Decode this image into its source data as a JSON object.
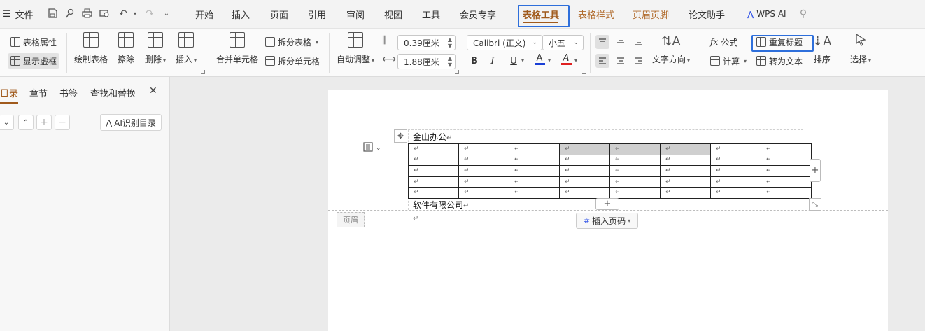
{
  "menubar": {
    "menu_icon": "☰",
    "file_label": "文件",
    "icons": [
      "save-icon",
      "brush-icon",
      "print-icon",
      "print-preview-icon",
      "undo-icon",
      "redo-icon"
    ],
    "tabs": [
      {
        "label": "开始",
        "name": "tab-home"
      },
      {
        "label": "插入",
        "name": "tab-insert"
      },
      {
        "label": "页面",
        "name": "tab-page"
      },
      {
        "label": "引用",
        "name": "tab-reference"
      },
      {
        "label": "审阅",
        "name": "tab-review"
      },
      {
        "label": "视图",
        "name": "tab-view"
      },
      {
        "label": "工具",
        "name": "tab-tools"
      },
      {
        "label": "会员专享",
        "name": "tab-member"
      },
      {
        "label": "表格工具",
        "name": "tab-table-tools"
      },
      {
        "label": "表格样式",
        "name": "tab-table-style"
      },
      {
        "label": "页眉页脚",
        "name": "tab-header-footer"
      },
      {
        "label": "论文助手",
        "name": "tab-paper-assistant"
      }
    ],
    "active_tab": "表格工具",
    "wps_ai_label": "WPS AI"
  },
  "ribbon": {
    "table_props": "表格属性",
    "show_gridlines": "显示虚框",
    "draw_table": "绘制表格",
    "erase": "擦除",
    "delete": "删除",
    "insert": "插入",
    "merge_cells": "合并单元格",
    "split_table": "拆分表格",
    "split_cells": "拆分单元格",
    "auto_fit": "自动调整",
    "row_height": "0.39厘米",
    "col_width": "1.88厘米",
    "font_name": "Calibri (正文)",
    "font_size": "小五",
    "bold": "B",
    "italic": "I",
    "underline": "U",
    "font_color": "A",
    "highlight": "A",
    "text_direction": "文字方向",
    "formula": "公式",
    "formula_icon": "fx",
    "calculate": "计算",
    "repeat_header": "重复标题",
    "convert_to_text": "转为文本",
    "sort": "排序",
    "select": "选择"
  },
  "colors": {
    "accent": "#a05a1c",
    "highlight_box": "#2e6fdb",
    "font_color_bar": "#1a3fd6",
    "highlight_color_bar": "#e02020"
  },
  "nav": {
    "tabs": [
      "目录",
      "章节",
      "书签",
      "查找和替换"
    ],
    "active_tab": "目录",
    "close": "✕",
    "ai_toc": "AI识别目录"
  },
  "document": {
    "header_text": "金山办公",
    "footer_text": "软件有限公司",
    "para_mark": "↵",
    "table": {
      "rows": 5,
      "cols": 8,
      "cells": [
        [
          "↵",
          "↵",
          "↵",
          "↵",
          "↵",
          "↵",
          "↵",
          "↵"
        ],
        [
          "↵",
          "↵",
          "↵",
          "↵",
          "↵",
          "↵",
          "↵",
          "↵"
        ],
        [
          "↵",
          "↵",
          "↵",
          "↵",
          "↵",
          "↵",
          "↵",
          "↵"
        ],
        [
          "↵",
          "↵",
          "↵",
          "↵",
          "↵",
          "↵",
          "↵",
          "↵"
        ],
        [
          "↵",
          "↵",
          "↵",
          "↵",
          "↵",
          "↵",
          "↵",
          "↵"
        ]
      ],
      "shaded_cells": [
        [
          0,
          3
        ],
        [
          0,
          4
        ],
        [
          0,
          5
        ]
      ]
    },
    "header_label": "页眉",
    "insert_page_number": "插入页码"
  }
}
